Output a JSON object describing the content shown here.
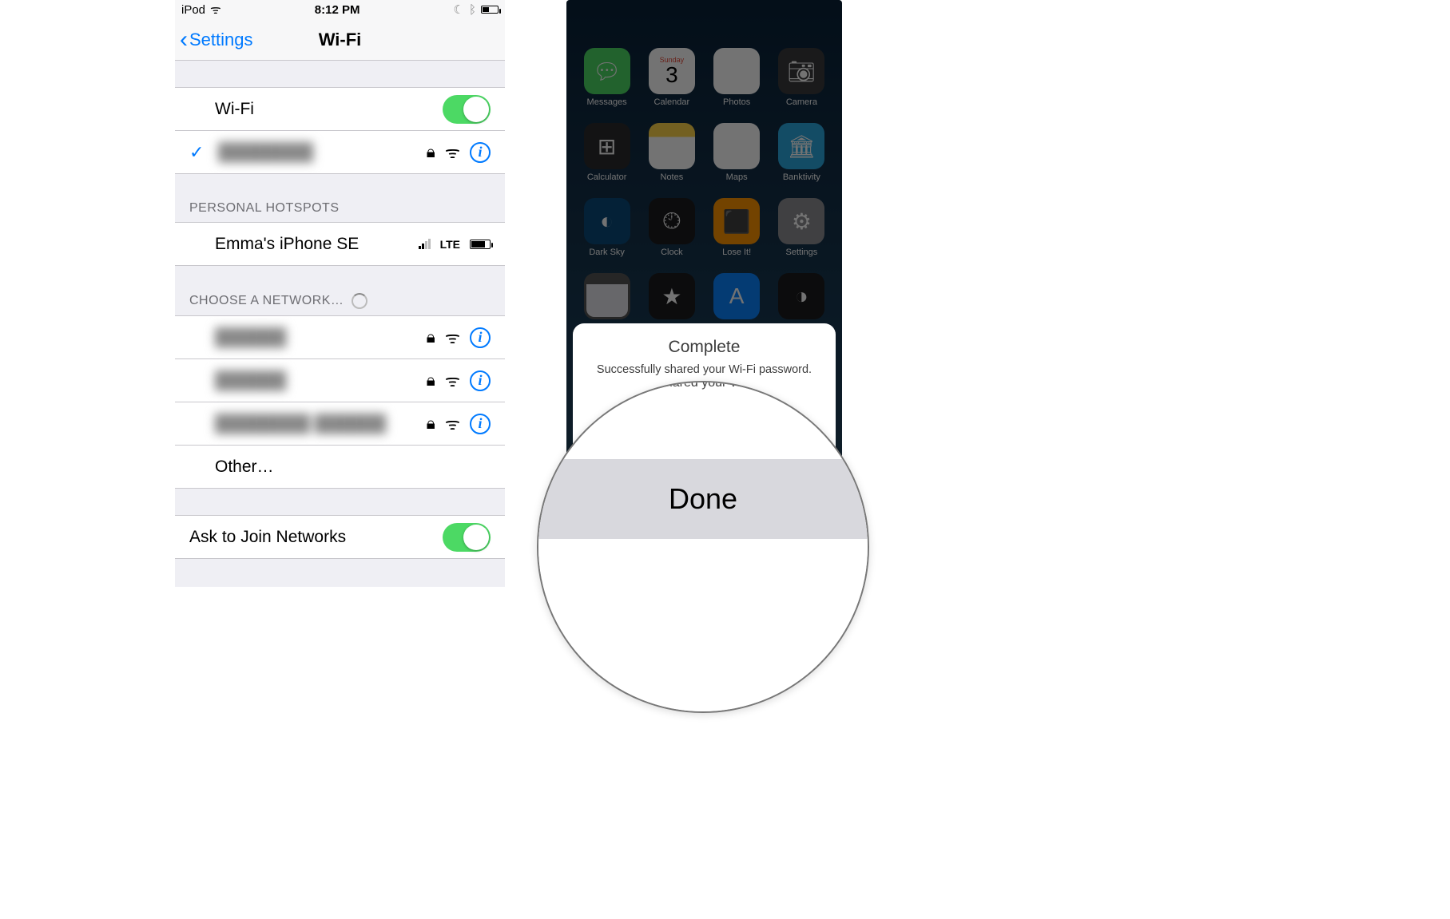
{
  "left": {
    "status": {
      "device": "iPod",
      "time": "8:12 PM"
    },
    "nav": {
      "back": "Settings",
      "title": "Wi-Fi"
    },
    "wifi_toggle_label": "Wi-Fi",
    "connected_network": "████████",
    "section_hotspots": "PERSONAL HOTSPOTS",
    "hotspot": {
      "name": "Emma's iPhone SE",
      "signal": "LTE"
    },
    "section_choose": "CHOOSE A NETWORK…",
    "networks": [
      "██████",
      "██████",
      "████████ ██████"
    ],
    "other": "Other…",
    "ask_label": "Ask to Join Networks"
  },
  "right": {
    "calendar": {
      "dow": "Sunday",
      "day": "3"
    },
    "apps_row1": [
      "Messages",
      "Calendar",
      "Photos",
      "Camera"
    ],
    "apps_row2": [
      "Calculator",
      "Notes",
      "Maps",
      "Banktivity"
    ],
    "apps_row3": [
      "Dark Sky",
      "Clock",
      "Lose It!",
      "Settings"
    ],
    "share": {
      "title": "Complete",
      "subtitle": "Successfully shared your Wi-Fi password.",
      "done": "Done"
    }
  }
}
